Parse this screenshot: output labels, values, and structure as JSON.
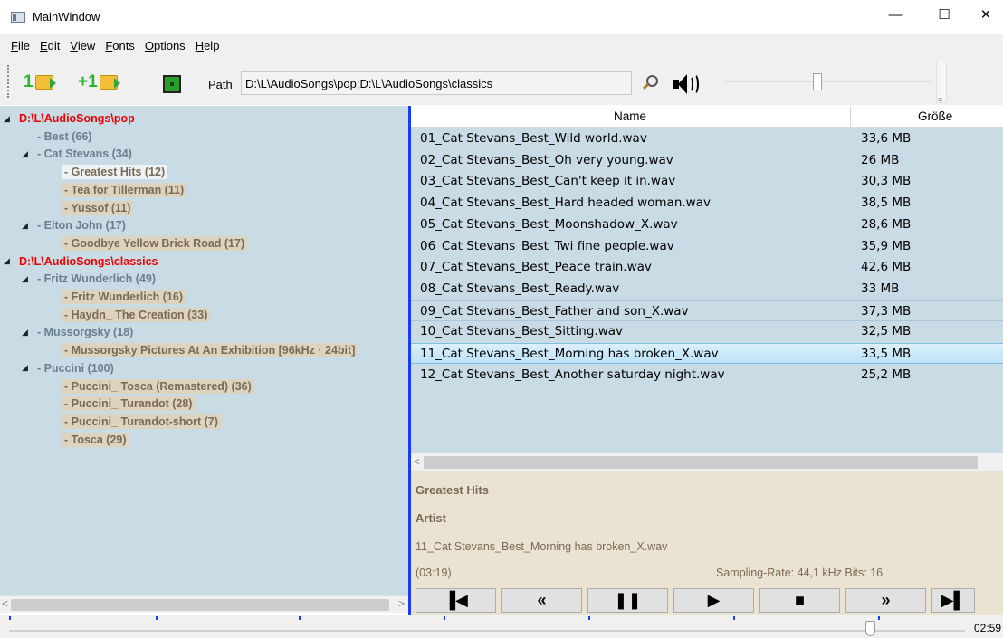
{
  "window": {
    "title": "MainWindow",
    "minimize": "—",
    "maximize": "☐",
    "close": "✕"
  },
  "menu": [
    {
      "acc": "F",
      "rest": "ile"
    },
    {
      "acc": "E",
      "rest": "dit"
    },
    {
      "acc": "V",
      "rest": "iew"
    },
    {
      "acc": "F",
      "rest": "onts"
    },
    {
      "acc": "O",
      "rest": "ptions"
    },
    {
      "acc": "H",
      "rest": "elp"
    }
  ],
  "toolbar": {
    "open_one_label": "1",
    "add_one_label": "+1",
    "path_label": "Path",
    "path_value": "D:\\L\\AudioSongs\\pop;D:\\L\\AudioSongs\\classics",
    "volume_level": 0.43
  },
  "tree": [
    {
      "label": "D:\\L\\AudioSongs\\pop",
      "type": "root",
      "toggle": "◢"
    },
    {
      "label": "- Best (66)",
      "type": "branch",
      "toggle": ""
    },
    {
      "label": "- Cat Stevans (34)",
      "type": "branch",
      "toggle": "◢"
    },
    {
      "label": "- Greatest Hits (12)",
      "type": "leaf",
      "toggle": "",
      "selected": true
    },
    {
      "label": "- Tea for Tillerman (11)",
      "type": "leaf",
      "toggle": ""
    },
    {
      "label": "- Yussof (11)",
      "type": "leaf",
      "toggle": ""
    },
    {
      "label": "- Elton John (17)",
      "type": "branch",
      "toggle": "◢"
    },
    {
      "label": "- Goodbye Yellow Brick Road (17)",
      "type": "leaf",
      "toggle": ""
    },
    {
      "label": "D:\\L\\AudioSongs\\classics",
      "type": "root",
      "toggle": "◢"
    },
    {
      "label": "- Fritz Wunderlich (49)",
      "type": "branch",
      "toggle": "◢"
    },
    {
      "label": "- Fritz Wunderlich (16)",
      "type": "leaf",
      "toggle": ""
    },
    {
      "label": "- Haydn_ The Creation (33)",
      "type": "leaf",
      "toggle": ""
    },
    {
      "label": "- Mussorgsky (18)",
      "type": "branch",
      "toggle": "◢"
    },
    {
      "label": "- Mussorgsky  Pictures At An Exhibition [96kHz · 24bit]",
      "type": "leaf",
      "toggle": ""
    },
    {
      "label": "- Puccini (100)",
      "type": "branch",
      "toggle": "◢"
    },
    {
      "label": "- Puccini_ Tosca (Remastered) (36)",
      "type": "leaf",
      "toggle": ""
    },
    {
      "label": "- Puccini_ Turandot (28)",
      "type": "leaf",
      "toggle": ""
    },
    {
      "label": "- Puccini_ Turandot-short (7)",
      "type": "leaf",
      "toggle": ""
    },
    {
      "label": "- Tosca (29)",
      "type": "leaf",
      "toggle": ""
    }
  ],
  "grid": {
    "columns": {
      "name": "Name",
      "size": "Größe"
    },
    "rows": [
      {
        "name": "01_Cat Stevans_Best_Wild world.wav",
        "size": "33,6 MB"
      },
      {
        "name": "02_Cat Stevans_Best_Oh very young.wav",
        "size": "26 MB"
      },
      {
        "name": "03_Cat Stevans_Best_Can't keep it in.wav",
        "size": "30,3 MB"
      },
      {
        "name": "04_Cat Stevans_Best_Hard headed woman.wav",
        "size": "38,5 MB"
      },
      {
        "name": "05_Cat Stevans_Best_Moonshadow_X.wav",
        "size": "28,6 MB"
      },
      {
        "name": "06_Cat Stevans_Best_Twi fine people.wav",
        "size": "35,9 MB"
      },
      {
        "name": "07_Cat Stevans_Best_Peace train.wav",
        "size": "42,6 MB"
      },
      {
        "name": "08_Cat Stevans_Best_Ready.wav",
        "size": "33 MB"
      },
      {
        "name": "09_Cat Stevans_Best_Father and son_X.wav",
        "size": "37,3 MB",
        "state": "focused"
      },
      {
        "name": "10_Cat Stevans_Best_Sitting.wav",
        "size": "32,5 MB"
      },
      {
        "name": "11_Cat Stevans_Best_Morning has broken_X.wav",
        "size": "33,5 MB",
        "state": "selected"
      },
      {
        "name": "12_Cat Stevans_Best_Another saturday night.wav",
        "size": "25,2 MB"
      }
    ]
  },
  "info": {
    "album": "Greatest Hits",
    "artist": "Artist",
    "file": "11_Cat Stevans_Best_Morning has broken_X.wav",
    "duration": "(03:19)",
    "sampling": "Sampling-Rate: 44,1 kHz  Bits: 16"
  },
  "transport": [
    {
      "name": "previous-track-button",
      "glyph": "▐◀"
    },
    {
      "name": "rewind-button",
      "glyph": "«"
    },
    {
      "name": "pause-button",
      "glyph": "❚❚"
    },
    {
      "name": "play-button",
      "glyph": "▶"
    },
    {
      "name": "stop-button",
      "glyph": "■"
    },
    {
      "name": "fast-forward-button",
      "glyph": "»"
    },
    {
      "name": "next-track-button",
      "glyph": "▶▌"
    }
  ],
  "seek": {
    "time": "02:59",
    "position": 0.905
  },
  "colors": {
    "splitter": "#1a3aff",
    "root_folder": "#f00000",
    "panel": "#c9dbe4",
    "info_bg": "#ebe3d2"
  }
}
